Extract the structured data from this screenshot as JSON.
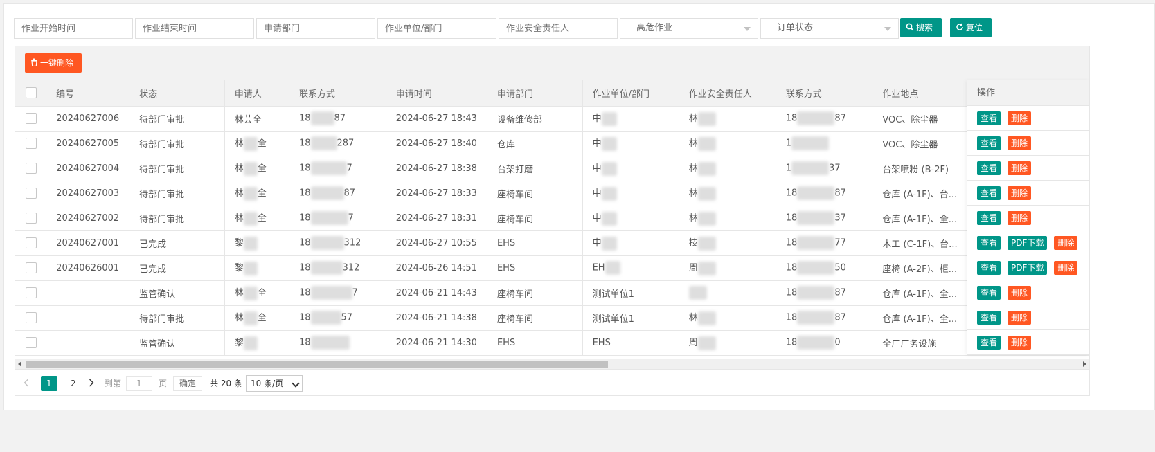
{
  "filters": {
    "start_time": "作业开始时间",
    "end_time": "作业结束时间",
    "apply_dept": "申请部门",
    "work_unit": "作业单位/部门",
    "safety_person": "作业安全责任人",
    "high_risk": "—高危作业—",
    "order_status": "—订单状态—",
    "search_label": "搜索",
    "reset_label": "复位"
  },
  "toolbar": {
    "bulk_delete_label": "一键删除"
  },
  "table": {
    "headers": [
      "编号",
      "状态",
      "申请人",
      "联系方式",
      "申请时间",
      "申请部门",
      "作业单位/部门",
      "作业安全责任人",
      "联系方式",
      "作业地点",
      "操作"
    ],
    "rows": [
      {
        "id": "20240627006",
        "status": "待部门审批",
        "applicant": "林芸全",
        "phone": "18",
        "phone_end": "87",
        "time": "2024-06-27 18:43",
        "dept": "设备维修部",
        "unit": "中",
        "safety": "林",
        "phone2": "18",
        "phone2_end": "87",
        "location": "VOC、除尘器"
      },
      {
        "id": "20240627005",
        "status": "待部门审批",
        "applicant": "林",
        "applicant_end": "全",
        "phone": "18",
        "phone_end": "287",
        "time": "2024-06-27 18:40",
        "dept": "仓库",
        "unit": "中",
        "safety": "林",
        "phone2": "1",
        "phone2_end": "",
        "location": "VOC、除尘器"
      },
      {
        "id": "20240627004",
        "status": "待部门审批",
        "applicant": "林",
        "applicant_end": "全",
        "phone": "18",
        "phone_end": "7",
        "time": "2024-06-27 18:38",
        "dept": "台架打磨",
        "unit": "中",
        "safety": "林",
        "phone2": "1",
        "phone2_end": "37",
        "location": "台架喷粉 (B-2F)"
      },
      {
        "id": "20240627003",
        "status": "待部门审批",
        "applicant": "林",
        "applicant_end": "全",
        "phone": "18",
        "phone_end": "87",
        "time": "2024-06-27 18:33",
        "dept": "座椅车间",
        "unit": "中",
        "safety": "林",
        "phone2": "18",
        "phone2_end": "87",
        "location": "仓库 (A-1F)、台..."
      },
      {
        "id": "20240627002",
        "status": "待部门审批",
        "applicant": "林",
        "applicant_end": "全",
        "phone": "18",
        "phone_end": "7",
        "time": "2024-06-27 18:31",
        "dept": "座椅车间",
        "unit": "中",
        "safety": "林",
        "phone2": "18",
        "phone2_end": "37",
        "location": "仓库 (A-1F)、全..."
      },
      {
        "id": "20240627001",
        "status": "已完成",
        "applicant": "黎",
        "applicant_end": "",
        "phone": "18",
        "phone_end": "312",
        "time": "2024-06-27 10:55",
        "dept": "EHS",
        "unit": "中",
        "safety": "技",
        "phone2": "18",
        "phone2_end": "77",
        "location": "木工 (C-1F)、台..."
      },
      {
        "id": "20240626001",
        "status": "已完成",
        "applicant": "黎",
        "applicant_end": "",
        "phone": "18",
        "phone_end": "312",
        "time": "2024-06-26 14:51",
        "dept": "EHS",
        "unit": "EH",
        "safety": "周",
        "phone2": "18",
        "phone2_end": "50",
        "location": "座椅 (A-2F)、柜..."
      },
      {
        "id": "",
        "status": "监管确认",
        "applicant": "林",
        "applicant_end": "全",
        "phone": "18",
        "phone_end": "7",
        "time": "2024-06-21 14:43",
        "dept": "座椅车间",
        "unit": "测试单位1",
        "safety": "",
        "phone2": "18",
        "phone2_end": "87",
        "location": "仓库 (A-1F)、全..."
      },
      {
        "id": "",
        "status": "待部门审批",
        "applicant": "林",
        "applicant_end": "全",
        "phone": "18",
        "phone_end": "57",
        "time": "2024-06-21 14:38",
        "dept": "座椅车间",
        "unit": "测试单位1",
        "safety": "林",
        "phone2": "18",
        "phone2_end": "87",
        "location": "仓库 (A-1F)、全..."
      },
      {
        "id": "",
        "status": "监管确认",
        "applicant": "黎",
        "applicant_end": "",
        "phone": "18",
        "phone_end": "",
        "time": "2024-06-21 14:30",
        "dept": "EHS",
        "unit": "EHS",
        "safety": "周",
        "phone2": "18",
        "phone2_end": "0",
        "location": "全厂厂务设施"
      }
    ],
    "actions": {
      "view": "查看",
      "delete": "删除",
      "pdf": "PDF下载"
    },
    "pdf_rows": [
      5,
      6
    ]
  },
  "pagination": {
    "current": "1",
    "next_page": "2",
    "goto_prefix": "到第",
    "goto_value": "1",
    "goto_suffix": "页",
    "confirm": "确定",
    "total": "共 20 条",
    "page_size": "10 条/页"
  }
}
